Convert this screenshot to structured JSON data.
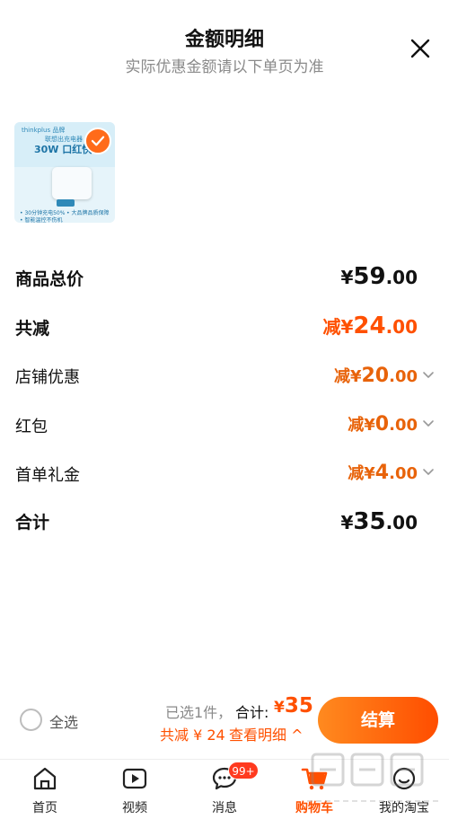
{
  "header": {
    "title": "金额明细",
    "subtitle": "实际优惠金额请以下单页为准"
  },
  "product": {
    "brand": "thinkplus 品牌",
    "sub": "联想出充电器",
    "headline": "30W 口红快",
    "features": [
      "• 30分钟充电50%",
      "• 大品牌品质保障",
      "• 智能温控不伤机"
    ]
  },
  "summary": {
    "rows": [
      {
        "label": "商品总价",
        "prefix": "",
        "currency": "¥",
        "integer": "59",
        "decimal": ".00"
      },
      {
        "label": "共减",
        "prefix": "减",
        "currency": "¥",
        "integer": "24",
        "decimal": ".00"
      },
      {
        "label": "店铺优惠",
        "prefix": "减",
        "currency": "¥",
        "integer": "20",
        "decimal": ".00"
      },
      {
        "label": "红包",
        "prefix": "减",
        "currency": "¥",
        "integer": "0",
        "decimal": ".00"
      },
      {
        "label": "首单礼金",
        "prefix": "减",
        "currency": "¥",
        "integer": "4",
        "decimal": ".00"
      },
      {
        "label": "合计",
        "prefix": "",
        "currency": "¥",
        "integer": "35",
        "decimal": ".00"
      }
    ]
  },
  "bottom_bar": {
    "select_all": "全选",
    "selected_count": "已选1件，",
    "total_label": "合计:",
    "total_currency": "¥",
    "total_value": "35",
    "discount": "共减 ¥ 24",
    "view_detail": "查看明细 ^",
    "checkout": "结算"
  },
  "tabs": [
    {
      "label": "首页",
      "icon": "home-icon"
    },
    {
      "label": "视频",
      "icon": "video-icon"
    },
    {
      "label": "消息",
      "icon": "message-icon",
      "badge": "99+"
    },
    {
      "label": "购物车",
      "icon": "cart-icon",
      "active": true
    },
    {
      "label": "我的淘宝",
      "icon": "profile-icon"
    }
  ],
  "colors": {
    "accent": "#ff5000",
    "discount_orange": "#e8630a",
    "badge": "#ff3a1f"
  }
}
